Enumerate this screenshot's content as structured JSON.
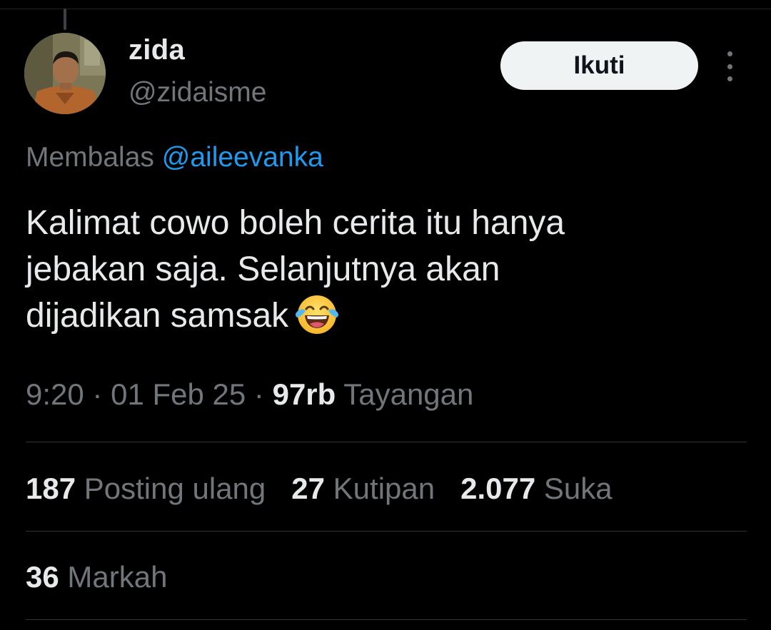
{
  "author": {
    "display_name": "zida",
    "handle": "@zidaisme",
    "avatar_icon": "profile-photo"
  },
  "follow_button": {
    "label": "Ikuti"
  },
  "more_menu": {
    "icon": "more-vertical-icon"
  },
  "reply_context": {
    "prefix": "Membalas",
    "mention": "@aileevanka"
  },
  "tweet": {
    "lines": [
      "Kalimat cowo boleh cerita itu hanya",
      "jebakan saja. Selanjutnya akan",
      "dijadikan samsak"
    ],
    "emoji": "face-with-tears-of-joy"
  },
  "meta": {
    "time": "9:20",
    "separator": "·",
    "date": "01 Feb 25",
    "views_count": "97rb",
    "views_label": "Tayangan"
  },
  "stats": [
    {
      "count": "187",
      "label": "Posting ulang"
    },
    {
      "count": "27",
      "label": "Kutipan"
    },
    {
      "count": "2.077",
      "label": "Suka"
    }
  ],
  "bookmarks": {
    "count": "36",
    "label": "Markah"
  },
  "colors": {
    "background": "#000000",
    "primary_text": "#e7e9ea",
    "secondary_text": "#71767b",
    "link": "#1d9bf0",
    "divider": "#2f3336",
    "button_bg": "#eff3f4"
  }
}
